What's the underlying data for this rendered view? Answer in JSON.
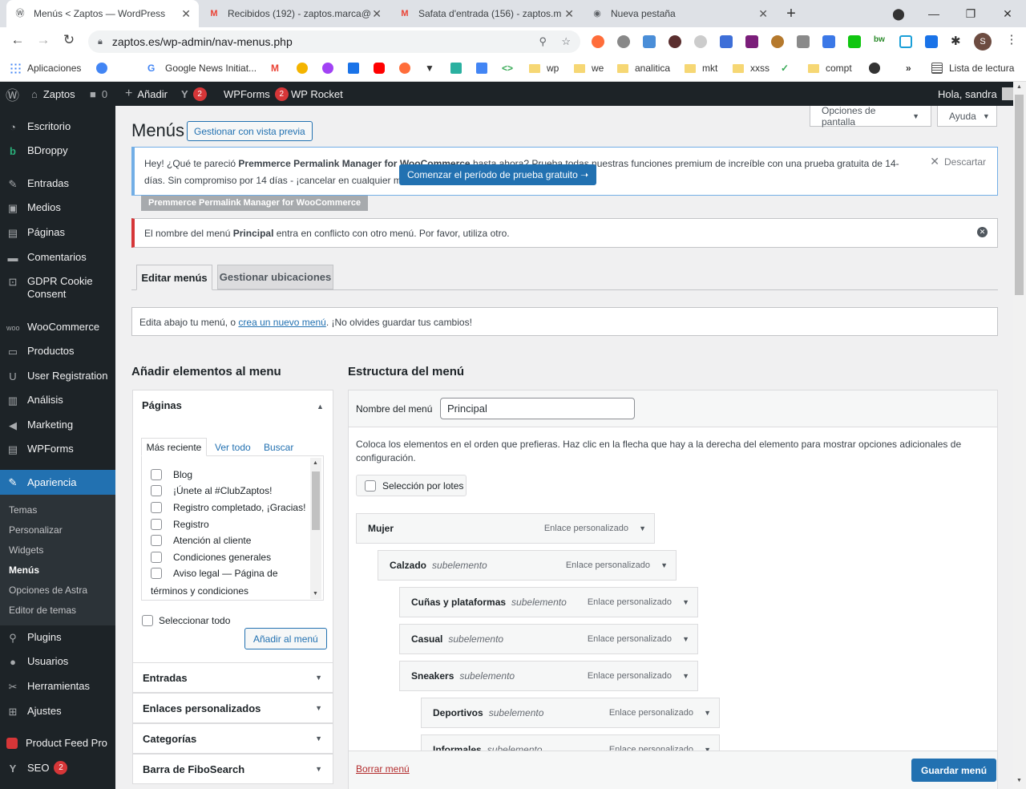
{
  "browser": {
    "tabs": [
      {
        "title": "Menús < Zaptos — WordPress",
        "icon": "wordpress-icon"
      },
      {
        "title": "Recibidos (192) - zaptos.marca@",
        "icon": "gmail-icon"
      },
      {
        "title": "Safata d'entrada (156) - zaptos.m",
        "icon": "gmail-icon"
      },
      {
        "title": "Nueva pestaña",
        "icon": "chrome-icon"
      }
    ],
    "url": "zaptos.es/wp-admin/nav-menus.php",
    "profile_initial": "S",
    "bookmarks": [
      {
        "label": "Aplicaciones",
        "icon": "apps-icon"
      },
      {
        "label": "Google News Initiat...",
        "icon": "google-icon"
      },
      {
        "label": "wp",
        "icon": "folder-icon"
      },
      {
        "label": "we",
        "icon": "folder-icon"
      },
      {
        "label": "analitica",
        "icon": "folder-icon"
      },
      {
        "label": "mkt",
        "icon": "folder-icon"
      },
      {
        "label": "xxss",
        "icon": "folder-icon"
      },
      {
        "label": "compt",
        "icon": "folder-icon"
      },
      {
        "label": "Lista de lectura",
        "icon": "reading-list-icon"
      }
    ]
  },
  "adminbar": {
    "site": "Zaptos",
    "comments": "0",
    "add": "Añadir",
    "yoast_count": "2",
    "wpforms": "WPForms",
    "wpforms_count": "2",
    "wprocket": "WP Rocket",
    "greeting": "Hola, sandra"
  },
  "sidebar": {
    "items": [
      {
        "label": "Escritorio"
      },
      {
        "label": "BDroppy"
      },
      {
        "label": "Entradas"
      },
      {
        "label": "Medios"
      },
      {
        "label": "Páginas"
      },
      {
        "label": "Comentarios"
      },
      {
        "label": "GDPR Cookie Consent"
      },
      {
        "label": "WooCommerce"
      },
      {
        "label": "Productos"
      },
      {
        "label": "User Registration"
      },
      {
        "label": "Análisis"
      },
      {
        "label": "Marketing"
      },
      {
        "label": "WPForms"
      },
      {
        "label": "Apariencia"
      },
      {
        "label": "Plugins"
      },
      {
        "label": "Usuarios"
      },
      {
        "label": "Herramientas"
      },
      {
        "label": "Ajustes"
      },
      {
        "label": "Product Feed Pro"
      },
      {
        "label": "SEO",
        "badge": "2"
      }
    ],
    "appearance_sub": [
      "Temas",
      "Personalizar",
      "Widgets",
      "Menús",
      "Opciones de Astra",
      "Editor de temas"
    ]
  },
  "header": {
    "title": "Menús",
    "preview_btn": "Gestionar con vista previa",
    "screen_options": "Opciones de pantalla",
    "help": "Ayuda"
  },
  "promo": {
    "text_a": "Hey! ¿Qué te pareció ",
    "text_b": "Premmerce Permalink Manager for WooCommerce",
    "text_c": " hasta ahora? Prueba todas nuestras funciones premium de increíble con una prueba gratuita de 14-días. Sin compromiso por 14 días - ¡cancelar en cualquier momento!",
    "cta": "Comenzar el período de prueba gratuito ➝",
    "dismiss": "Descartar",
    "tag": "Premmerce Permalink Manager for WooCommerce"
  },
  "error": {
    "text_a": "El nombre del menú ",
    "text_b": "Principal",
    "text_c": " entra en conflicto con otro menú. Por favor, utiliza otro."
  },
  "nav_tabs": [
    "Editar menús",
    "Gestionar ubicaciones"
  ],
  "info": {
    "text_a": "Edita abajo tu menú, o ",
    "link": "crea un nuevo menú",
    "text_b": ". ¡No olvides guardar tus cambios!"
  },
  "add_items": {
    "title": "Añadir elementos al menu",
    "pages_title": "Páginas",
    "subtabs": [
      "Más reciente",
      "Ver todo",
      "Buscar"
    ],
    "pages": [
      "Blog",
      "¡Únete al #ClubZaptos!",
      "Registro completado, ¡Gracias!",
      "Registro",
      "Atención al cliente",
      "Condiciones generales",
      "Aviso legal — Página de",
      "términos y condiciones"
    ],
    "select_all": "Seleccionar todo",
    "add_btn": "Añadir al menú",
    "panels": [
      "Entradas",
      "Enlaces personalizados",
      "Categorías",
      "Barra de FiboSearch"
    ]
  },
  "structure": {
    "title": "Estructura del menú",
    "name_label": "Nombre del menú",
    "name_value": "Principal",
    "instructions": "Coloca los elementos en el orden que prefieras. Haz clic en la flecha que hay a la derecha del elemento para mostrar opciones adicionales de configuración.",
    "bulk": "Selección por lotes",
    "type_label": "Enlace personalizado",
    "sub_label": "subelemento",
    "items": [
      {
        "title": "Mujer",
        "depth": 0
      },
      {
        "title": "Calzado",
        "depth": 1
      },
      {
        "title": "Cuñas y plataformas",
        "depth": 2
      },
      {
        "title": "Casual",
        "depth": 2
      },
      {
        "title": "Sneakers",
        "depth": 2
      },
      {
        "title": "Deportivos",
        "depth": 3
      },
      {
        "title": "Informales",
        "depth": 3
      }
    ],
    "delete": "Borrar menú",
    "save": "Guardar menú"
  }
}
